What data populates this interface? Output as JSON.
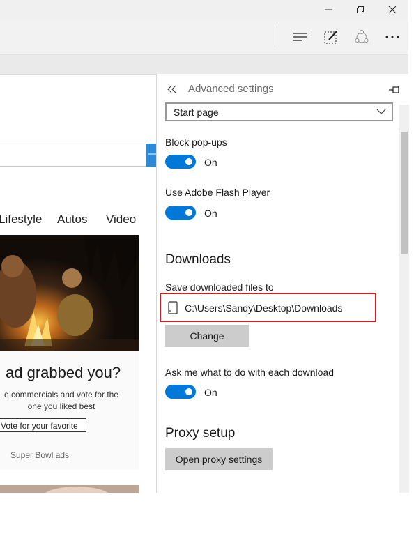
{
  "titlebar": {
    "minimize_icon": "minimize-icon",
    "restore_icon": "restore-icon",
    "close_icon": "close-icon"
  },
  "toolbar": {
    "hub_icon": "hub-icon",
    "note_icon": "web-note-icon",
    "share_icon": "share-icon",
    "more_icon": "more-icon"
  },
  "page": {
    "nav": [
      "Lifestyle",
      "Autos",
      "Video"
    ],
    "ad_title": "ad grabbed you?",
    "ad_desc": "e commercials and vote for the one you liked best",
    "vote_button": "Vote for your favorite",
    "ad_source": "Super Bowl ads"
  },
  "settings": {
    "title": "Advanced settings",
    "startpage_value": "Start page",
    "popups_label": "Block pop-ups",
    "popups_state": "On",
    "flash_label": "Use Adobe Flash Player",
    "flash_state": "On",
    "downloads_heading": "Downloads",
    "save_label": "Save downloaded files to",
    "download_path": "C:\\Users\\Sandy\\Desktop\\Downloads",
    "change_button": "Change",
    "ask_label": "Ask me what to do with each download",
    "ask_state": "On",
    "proxy_heading": "Proxy setup",
    "proxy_button": "Open proxy settings"
  },
  "colors": {
    "accent": "#0078d7",
    "highlight": "#cc2027"
  }
}
